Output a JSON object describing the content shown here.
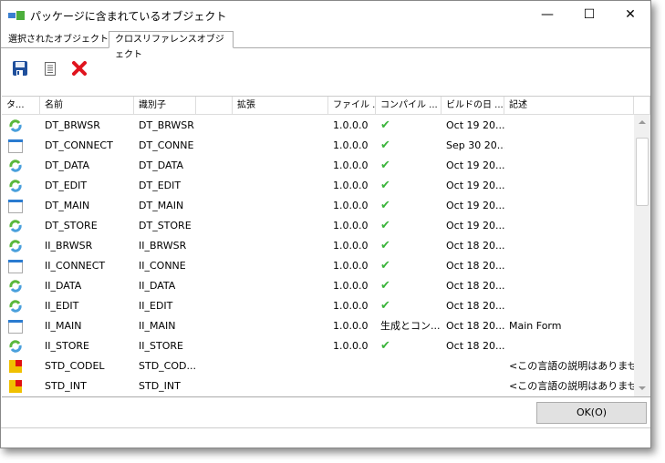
{
  "window": {
    "title": "パッケージに含まれているオブジェクト",
    "minimize": "—",
    "maximize": "☐",
    "close": "✕"
  },
  "tabs": [
    {
      "label": "選択されたオブジェクト"
    },
    {
      "label": "クロスリファレンスオブジェクト"
    }
  ],
  "toolbar": {
    "save": "save-icon",
    "report": "document-icon",
    "delete": "delete-icon"
  },
  "columns": [
    "タ...",
    "名前",
    "識別子",
    "",
    "拡張",
    "ファイル ...",
    "コンパイル ...",
    "ビルドの日 ...",
    "記述"
  ],
  "rows": [
    {
      "type": "refresh",
      "name": "DT_BRWSR",
      "id": "DT_BRWSR",
      "file": "1.0.0.0",
      "compile": "✔",
      "build": "Oct 19 20...",
      "desc": ""
    },
    {
      "type": "form",
      "name": "DT_CONNECT",
      "id": "DT_CONNE",
      "file": "1.0.0.0",
      "compile": "✔",
      "build": "Sep 30 20...",
      "desc": ""
    },
    {
      "type": "refresh",
      "name": "DT_DATA",
      "id": "DT_DATA",
      "file": "1.0.0.0",
      "compile": "✔",
      "build": "Oct 19 20...",
      "desc": ""
    },
    {
      "type": "refresh",
      "name": "DT_EDIT",
      "id": "DT_EDIT",
      "file": "1.0.0.0",
      "compile": "✔",
      "build": "Oct 19 20...",
      "desc": ""
    },
    {
      "type": "form",
      "name": "DT_MAIN",
      "id": "DT_MAIN",
      "file": "1.0.0.0",
      "compile": "✔",
      "build": "Oct 19 20...",
      "desc": ""
    },
    {
      "type": "refresh",
      "name": "DT_STORE",
      "id": "DT_STORE",
      "file": "1.0.0.0",
      "compile": "✔",
      "build": "Oct 19 20...",
      "desc": ""
    },
    {
      "type": "refresh",
      "name": "II_BRWSR",
      "id": "II_BRWSR",
      "file": "1.0.0.0",
      "compile": "✔",
      "build": "Oct 18 20...",
      "desc": ""
    },
    {
      "type": "form",
      "name": "II_CONNECT",
      "id": "II_CONNE",
      "file": "1.0.0.0",
      "compile": "✔",
      "build": "Oct 18 20...",
      "desc": ""
    },
    {
      "type": "refresh",
      "name": "II_DATA",
      "id": "II_DATA",
      "file": "1.0.0.0",
      "compile": "✔",
      "build": "Oct 18 20...",
      "desc": ""
    },
    {
      "type": "refresh",
      "name": "II_EDIT",
      "id": "II_EDIT",
      "file": "1.0.0.0",
      "compile": "✔",
      "build": "Oct 18 20...",
      "desc": ""
    },
    {
      "type": "form",
      "name": "II_MAIN",
      "id": "II_MAIN",
      "file": "1.0.0.0",
      "compile": "生成とコン...",
      "build": "Oct 18 20...",
      "desc": "Main Form"
    },
    {
      "type": "refresh",
      "name": "II_STORE",
      "id": "II_STORE",
      "file": "1.0.0.0",
      "compile": "✔",
      "build": "Oct 18 20...",
      "desc": ""
    },
    {
      "type": "blocks",
      "name": "STD_CODEL",
      "id": "STD_COD...",
      "file": "",
      "compile": "",
      "build": "",
      "desc": "<この言語の説明はありませ..."
    },
    {
      "type": "blocks",
      "name": "STD_INT",
      "id": "STD_INT",
      "file": "",
      "compile": "",
      "build": "",
      "desc": "<この言語の説明はありませ..."
    }
  ],
  "ok_label": "OK(O)"
}
